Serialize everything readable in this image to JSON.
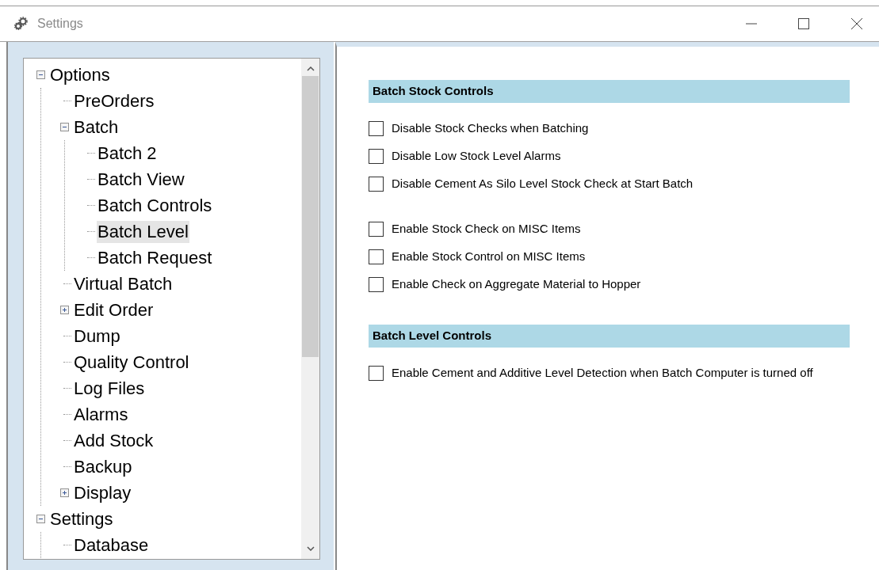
{
  "window": {
    "title": "Settings"
  },
  "tree": [
    {
      "label": "Options",
      "kind": "folder",
      "expanded": true,
      "selected": false,
      "children": [
        {
          "label": "PreOrders",
          "kind": "leaf",
          "selected": false
        },
        {
          "label": "Batch",
          "kind": "folder",
          "expanded": true,
          "selected": false,
          "children": [
            {
              "label": "Batch 2",
              "kind": "leaf",
              "selected": false
            },
            {
              "label": "Batch View",
              "kind": "leaf",
              "selected": false
            },
            {
              "label": "Batch Controls",
              "kind": "leaf",
              "selected": false
            },
            {
              "label": "Batch Level",
              "kind": "leaf",
              "selected": true
            },
            {
              "label": "Batch Request",
              "kind": "leaf",
              "selected": false
            }
          ]
        },
        {
          "label": "Virtual Batch",
          "kind": "leaf",
          "selected": false
        },
        {
          "label": "Edit Order",
          "kind": "folder",
          "expanded": false,
          "selected": false
        },
        {
          "label": "Dump",
          "kind": "leaf",
          "selected": false
        },
        {
          "label": "Quality Control",
          "kind": "leaf",
          "selected": false
        },
        {
          "label": "Log Files",
          "kind": "leaf",
          "selected": false
        },
        {
          "label": "Alarms",
          "kind": "leaf",
          "selected": false
        },
        {
          "label": "Add Stock",
          "kind": "leaf",
          "selected": false
        },
        {
          "label": "Backup",
          "kind": "leaf",
          "selected": false
        },
        {
          "label": "Display",
          "kind": "folder",
          "expanded": false,
          "selected": false
        }
      ]
    },
    {
      "label": "Settings",
      "kind": "folder",
      "expanded": true,
      "selected": false,
      "children": [
        {
          "label": "Database",
          "kind": "leaf",
          "selected": false
        }
      ]
    }
  ],
  "sections": [
    {
      "title": "Batch Stock Controls",
      "groups": [
        [
          {
            "label": "Disable Stock Checks when Batching",
            "checked": false
          },
          {
            "label": "Disable Low Stock Level Alarms",
            "checked": false
          },
          {
            "label": "Disable Cement As Silo Level Stock Check at Start Batch",
            "checked": false
          }
        ],
        [
          {
            "label": "Enable Stock Check on MISC Items",
            "checked": false
          },
          {
            "label": "Enable Stock Control on MISC Items",
            "checked": false
          },
          {
            "label": "Enable Check on Aggregate Material to Hopper",
            "checked": false
          }
        ]
      ]
    },
    {
      "title": "Batch Level Controls",
      "groups": [
        [
          {
            "label": "Enable Cement and Additive Level Detection when Batch Computer is turned off",
            "checked": false
          }
        ]
      ]
    }
  ]
}
